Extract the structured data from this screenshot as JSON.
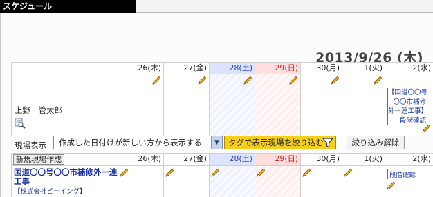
{
  "window": {
    "title": "スケジュール"
  },
  "header": {
    "date": "2013/9/26 (木)"
  },
  "days": [
    {
      "label": "26(木)",
      "kind": "weekday"
    },
    {
      "label": "27(金)",
      "kind": "weekday"
    },
    {
      "label": "28(土)",
      "kind": "sat"
    },
    {
      "label": "29(日)",
      "kind": "sun"
    },
    {
      "label": "30(月)",
      "kind": "weekday"
    },
    {
      "label": "1(火)",
      "kind": "weekday"
    },
    {
      "label": "2(水)",
      "kind": "weekday"
    }
  ],
  "staff_row": {
    "name": "上野　管太郎",
    "event_lines": [
      "【国道〇〇号",
      "〇〇市補修",
      "外ー連工事】",
      "段階確認"
    ]
  },
  "filter_bar": {
    "label": "現場表示",
    "sort_option": "作成した日付けが新しい方から表示する",
    "tag_filter_button": "タグで表示現場を絞り込む",
    "clear_button": "絞り込み解除"
  },
  "site_section": {
    "new_site_button": "新規現場作成",
    "site_name": "国道〇〇号〇〇市補修外ー連工事",
    "company": "【株式会社ピーイング】",
    "event_label": "段階確認"
  },
  "colors": {
    "saturday": "#3344cc",
    "sunday": "#cc2222",
    "tag_button": "#f5cf1c",
    "link": "#1a2fa0"
  },
  "icons": [
    "pencil-icon",
    "magnifier-icon",
    "funnel-icon",
    "dropdown-arrow-icon"
  ]
}
